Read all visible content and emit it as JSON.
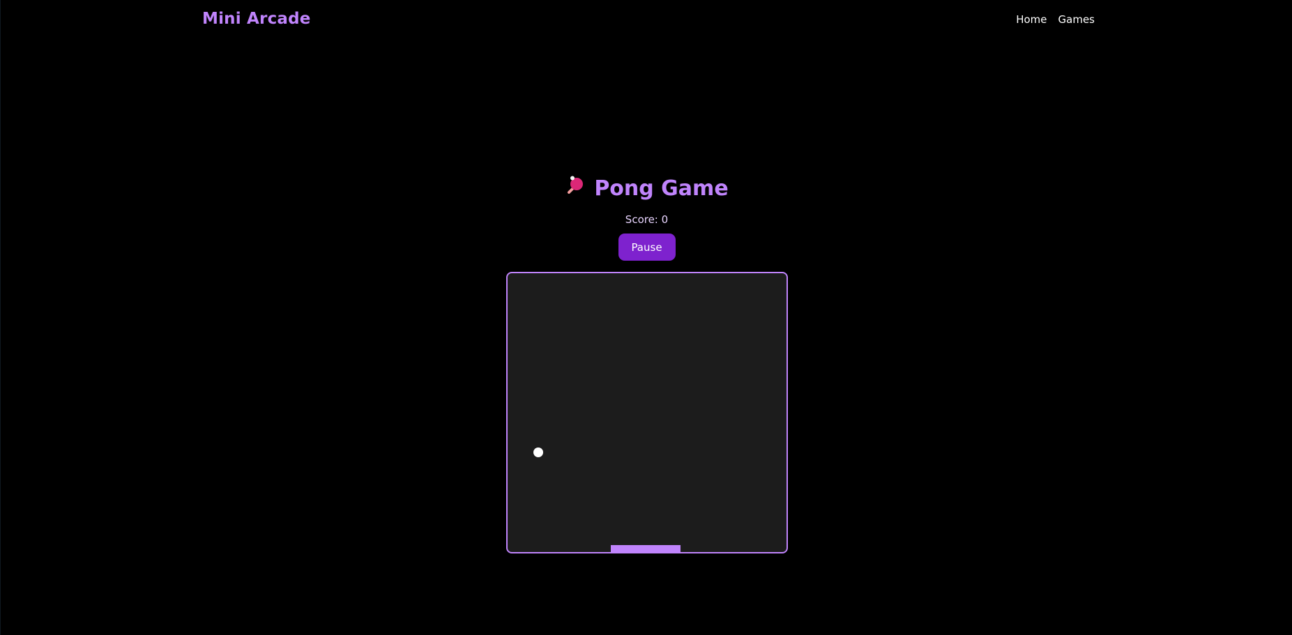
{
  "header": {
    "brand": "Mini Arcade",
    "nav": [
      {
        "label": "Home"
      },
      {
        "label": "Games"
      }
    ]
  },
  "game": {
    "title": "Pong Game",
    "title_icon": "ping-pong-paddle-icon",
    "score_text": "Score: 0",
    "pause_label": "Pause"
  },
  "colors": {
    "accent": "#c084fc",
    "button": "#7e22ce",
    "board": "#1c1c1c",
    "background": "#000000"
  }
}
